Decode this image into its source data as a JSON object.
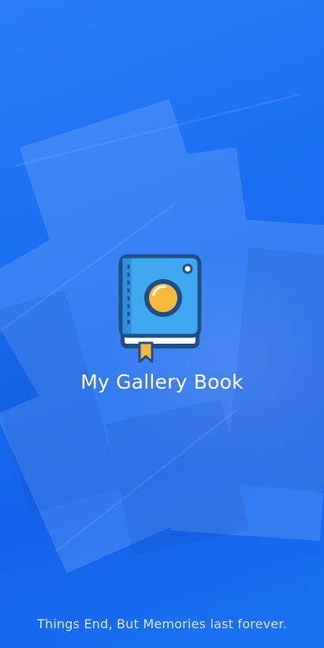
{
  "app": {
    "title": "My Gallery Book",
    "tagline": "Things End, But Memories last forever."
  },
  "icons": {
    "logo": "photo-album-book-icon"
  },
  "colors": {
    "background": "#1a6ef2",
    "book_cover": "#3fa8f0",
    "book_spine": "#1f4f86",
    "lens": "#f7b93d",
    "bookmark": "#f7b93d",
    "text": "#ffffff",
    "tagline": "#d7e6ff"
  }
}
